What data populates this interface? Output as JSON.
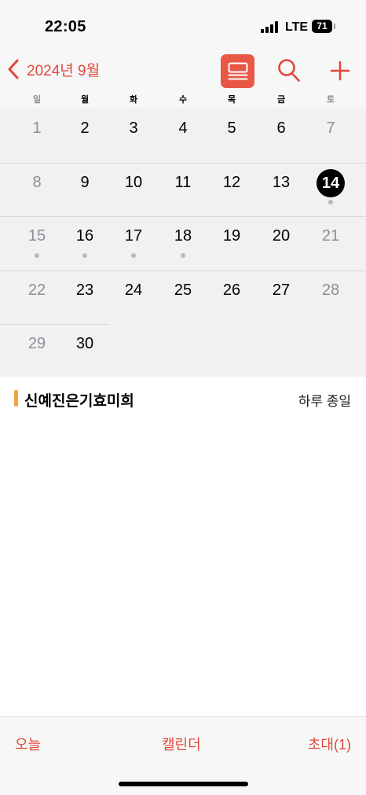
{
  "status_bar": {
    "time": "22:05",
    "network": "LTE",
    "battery": "71"
  },
  "header": {
    "back_label": "2024년 9월",
    "list_icon": "list-view-icon",
    "search_icon": "search-icon",
    "add_icon": "plus-icon",
    "accent_color": "#e2473b"
  },
  "weekdays": [
    "일",
    "월",
    "화",
    "수",
    "목",
    "금",
    "토"
  ],
  "calendar": {
    "month": "9월",
    "today": "14",
    "weeks": [
      [
        "1",
        "2",
        "3",
        "4",
        "5",
        "6",
        "7"
      ],
      [
        "8",
        "9",
        "10",
        "11",
        "12",
        "13",
        "14"
      ],
      [
        "15",
        "16",
        "17",
        "18",
        "19",
        "20",
        "21"
      ],
      [
        "22",
        "23",
        "24",
        "25",
        "26",
        "27",
        "28"
      ],
      [
        "29",
        "30"
      ]
    ],
    "days_with_events": [
      "14",
      "15",
      "16",
      "17",
      "18"
    ]
  },
  "events": [
    {
      "title": "신예진은기효미희",
      "time": "하루 종일",
      "color": "#f0a53c"
    }
  ],
  "tab_bar": {
    "today": "오늘",
    "calendars": "캘린더",
    "inbox": "초대(1)"
  }
}
